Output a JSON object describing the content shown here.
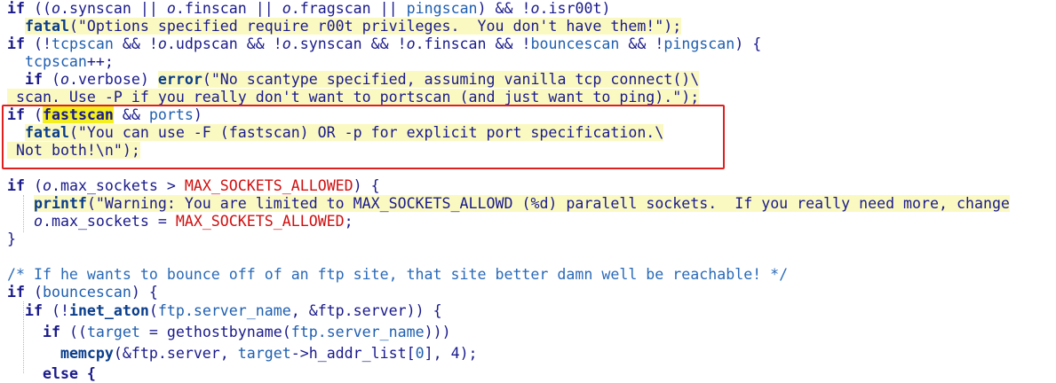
{
  "code_lines": [
    [
      {
        "t": "if ",
        "c": "kw"
      },
      {
        "t": "((",
        "c": "plain"
      },
      {
        "t": "o",
        "c": "ital"
      },
      {
        "t": ".synscan || ",
        "c": "plain"
      },
      {
        "t": "o",
        "c": "ital"
      },
      {
        "t": ".finscan || ",
        "c": "plain"
      },
      {
        "t": "o",
        "c": "ital"
      },
      {
        "t": ".fragscan || ",
        "c": "plain"
      },
      {
        "t": "pingscan",
        "c": "id"
      },
      {
        "t": ") && !",
        "c": "plain"
      },
      {
        "t": "o",
        "c": "ital"
      },
      {
        "t": ".isr00t)",
        "c": "plain"
      }
    ],
    [
      {
        "t": "  ",
        "c": "plain"
      },
      {
        "t": "fatal",
        "c": "func"
      },
      {
        "t": "(\"Options specified require r00t privileges.  You don't have them!\");",
        "c": "str"
      }
    ],
    [
      {
        "t": "if ",
        "c": "kw"
      },
      {
        "t": "(!",
        "c": "plain"
      },
      {
        "t": "tcpscan",
        "c": "id"
      },
      {
        "t": " && !",
        "c": "plain"
      },
      {
        "t": "o",
        "c": "ital"
      },
      {
        "t": ".udpscan && !",
        "c": "plain"
      },
      {
        "t": "o",
        "c": "ital"
      },
      {
        "t": ".synscan && !",
        "c": "plain"
      },
      {
        "t": "o",
        "c": "ital"
      },
      {
        "t": ".finscan && !",
        "c": "plain"
      },
      {
        "t": "bouncescan",
        "c": "id"
      },
      {
        "t": " && !",
        "c": "plain"
      },
      {
        "t": "pingscan",
        "c": "id"
      },
      {
        "t": ") {",
        "c": "plain"
      }
    ],
    [
      {
        "t": "  ",
        "c": "plain"
      },
      {
        "t": "tcpscan",
        "c": "id"
      },
      {
        "t": "++;",
        "c": "plain"
      }
    ],
    [
      {
        "t": "  ",
        "c": "plain"
      },
      {
        "t": "if ",
        "c": "kw"
      },
      {
        "t": "(",
        "c": "plain"
      },
      {
        "t": "o",
        "c": "ital"
      },
      {
        "t": ".verbose) ",
        "c": "plain"
      },
      {
        "t": "error",
        "c": "func"
      },
      {
        "t": "(\"No scantype specified, assuming vanilla tcp connect()\\",
        "c": "str"
      }
    ],
    [
      {
        "t": " scan. Use -P if you really don't want to portscan (and just want to ping).\");",
        "c": "str"
      }
    ],
    [
      {
        "t": "if ",
        "c": "kw"
      },
      {
        "t": "(",
        "c": "plain"
      },
      {
        "t": "fastscan",
        "c": "strong"
      },
      {
        "t": " && ",
        "c": "plain"
      },
      {
        "t": "ports",
        "c": "id"
      },
      {
        "t": ")",
        "c": "plain"
      }
    ],
    [
      {
        "t": "  ",
        "c": "plain"
      },
      {
        "t": "fatal",
        "c": "func"
      },
      {
        "t": "(\"You can use -F (fastscan) OR -p for explicit port specification.\\",
        "c": "str"
      }
    ],
    [
      {
        "t": " Not both!\\n\");",
        "c": "str"
      }
    ],
    [
      {
        "t": "if ",
        "c": "kw"
      },
      {
        "t": "(",
        "c": "plain"
      },
      {
        "t": "o",
        "c": "ital"
      },
      {
        "t": ".max_sockets > ",
        "c": "plain"
      },
      {
        "t": "MAX_SOCKETS_ALLOWED",
        "c": "macro"
      },
      {
        "t": ") {",
        "c": "plain"
      }
    ],
    [
      {
        "t": "   ",
        "c": "plain"
      },
      {
        "t": "printf",
        "c": "func"
      },
      {
        "t": "(\"Warning: You are limited to MAX_SOCKETS_ALLOWD (%d) paralell sockets.  If you really need more, change",
        "c": "str"
      }
    ],
    [
      {
        "t": "   ",
        "c": "plain"
      },
      {
        "t": "o",
        "c": "ital"
      },
      {
        "t": ".max_sockets = ",
        "c": "plain"
      },
      {
        "t": "MAX_SOCKETS_ALLOWED",
        "c": "macro"
      },
      {
        "t": ";",
        "c": "plain"
      }
    ],
    [
      {
        "t": "}",
        "c": "plain"
      }
    ],
    [
      {
        "t": "",
        "c": "plain"
      }
    ],
    [
      {
        "t": "/* If he wants to bounce off of an ftp site, that site better damn well be reachable! */",
        "c": "comment"
      }
    ],
    [
      {
        "t": "if ",
        "c": "kw"
      },
      {
        "t": "(",
        "c": "plain"
      },
      {
        "t": "bouncescan",
        "c": "id"
      },
      {
        "t": ") {",
        "c": "plain"
      }
    ],
    [
      {
        "t": "  ",
        "c": "plain"
      },
      {
        "t": "if ",
        "c": "kw"
      },
      {
        "t": "(!",
        "c": "plain"
      },
      {
        "t": "inet_aton",
        "c": "func"
      },
      {
        "t": "(",
        "c": "plain"
      },
      {
        "t": "ftp.server_name",
        "c": "id"
      },
      {
        "t": ", &ftp.server)) {",
        "c": "plain"
      }
    ],
    [
      {
        "t": "    ",
        "c": "plain"
      },
      {
        "t": "if ",
        "c": "kw"
      },
      {
        "t": "((",
        "c": "plain"
      },
      {
        "t": "target",
        "c": "id"
      },
      {
        "t": " = gethostbyname(",
        "c": "plain"
      },
      {
        "t": "ftp.server_name",
        "c": "id"
      },
      {
        "t": ")))",
        "c": "plain"
      }
    ],
    [
      {
        "t": "      ",
        "c": "plain"
      },
      {
        "t": "memcpy",
        "c": "func"
      },
      {
        "t": "(&ftp.server, ",
        "c": "plain"
      },
      {
        "t": "target",
        "c": "id"
      },
      {
        "t": "->h_addr_list[",
        "c": "plain"
      },
      {
        "t": "0",
        "c": "id"
      },
      {
        "t": "], 4);",
        "c": "plain"
      }
    ],
    [
      {
        "t": "    ",
        "c": "plain"
      },
      {
        "t": "else {",
        "c": "kw"
      }
    ]
  ],
  "highlight_box": {
    "label": "fastscan-ports-check",
    "color": "#e0201f"
  },
  "string_bg_color": "#fbf9c2",
  "search_match_color": "#f4f020"
}
